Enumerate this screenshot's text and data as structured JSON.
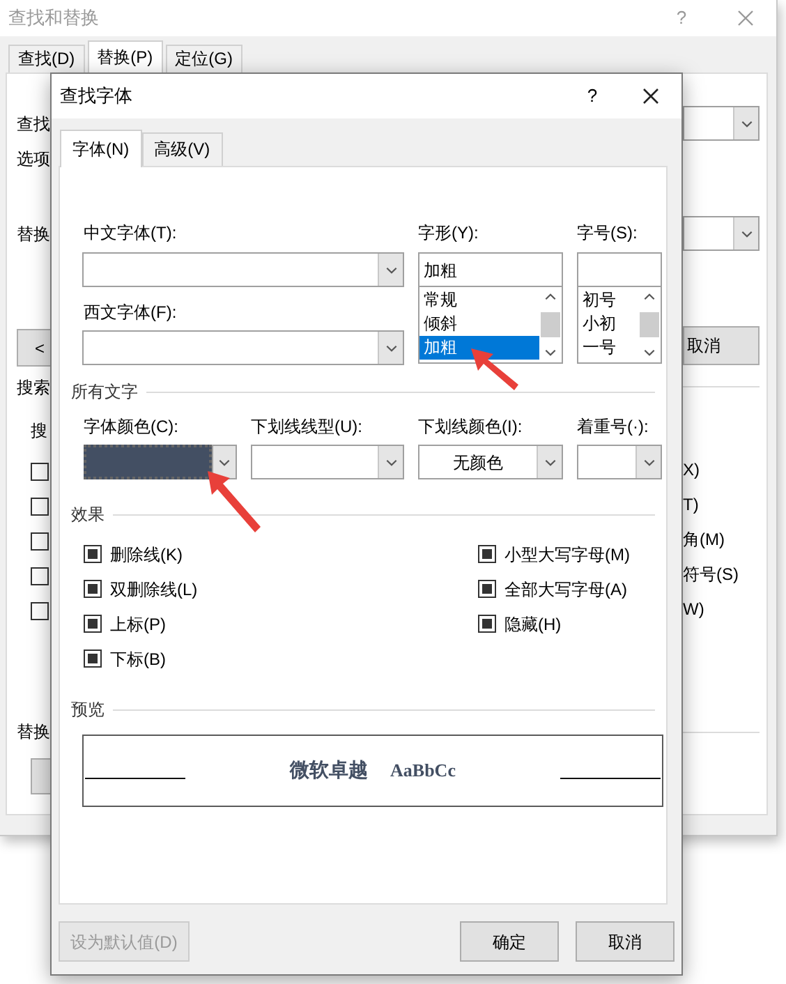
{
  "background_window": {
    "title": "查找和替换",
    "help": "?",
    "tabs": [
      {
        "label": "查找(D)",
        "selected": false
      },
      {
        "label": "替换(P)",
        "selected": true
      },
      {
        "label": "定位(G)",
        "selected": false
      }
    ],
    "find_label": "查找",
    "options_label": "选项",
    "replace_label": "替换",
    "less_button": "<",
    "search_label": "搜索",
    "search_sub_label": "搜",
    "option_checkboxes": [
      {
        "checked": false
      },
      {
        "checked": false
      },
      {
        "checked": false
      },
      {
        "checked": false
      },
      {
        "checked": false
      }
    ],
    "replace_section_label": "替换",
    "cancel_button": "取消",
    "option_label_tails": [
      "X)",
      "T)",
      "角(M)",
      "符号(S)",
      "W)"
    ]
  },
  "dialog": {
    "title": "查找字体",
    "help": "?",
    "tabs": [
      {
        "label": "字体(N)",
        "selected": true
      },
      {
        "label": "高级(V)",
        "selected": false
      }
    ],
    "chinese_font": {
      "label": "中文字体(T):"
    },
    "western_font": {
      "label": "西文字体(F):"
    },
    "font_style": {
      "label": "字形(Y):",
      "value": "加粗",
      "options": [
        {
          "label": "常规",
          "selected": false
        },
        {
          "label": "倾斜",
          "selected": false
        },
        {
          "label": "加粗",
          "selected": true
        }
      ]
    },
    "font_size": {
      "label": "字号(S):",
      "options": [
        {
          "label": "初号",
          "selected": false
        },
        {
          "label": "小初",
          "selected": false
        },
        {
          "label": "一号",
          "selected": false
        }
      ]
    },
    "all_text": {
      "title": "所有文字",
      "font_color": {
        "label": "字体颜色(C):",
        "color": "#434f63"
      },
      "underline_style": {
        "label": "下划线线型(U):"
      },
      "underline_color": {
        "label": "下划线颜色(I):",
        "value": "无颜色"
      },
      "emphasis": {
        "label": "着重号(·):"
      }
    },
    "effects": {
      "title": "效果",
      "left": [
        {
          "label": "删除线(K)",
          "checked": true
        },
        {
          "label": "双删除线(L)",
          "checked": true
        },
        {
          "label": "上标(P)",
          "checked": true
        },
        {
          "label": "下标(B)",
          "checked": true
        }
      ],
      "right": [
        {
          "label": "小型大写字母(M)",
          "checked": true
        },
        {
          "label": "全部大写字母(A)",
          "checked": true
        },
        {
          "label": "隐藏(H)",
          "checked": true
        }
      ]
    },
    "preview": {
      "title": "预览",
      "sample_cjk": "微软卓越",
      "sample_latin": "AaBbCc"
    },
    "buttons": [
      {
        "label": "设为默认值(D)",
        "disabled": true
      },
      {
        "label": "确定",
        "disabled": false
      },
      {
        "label": "取消",
        "disabled": false
      }
    ]
  }
}
